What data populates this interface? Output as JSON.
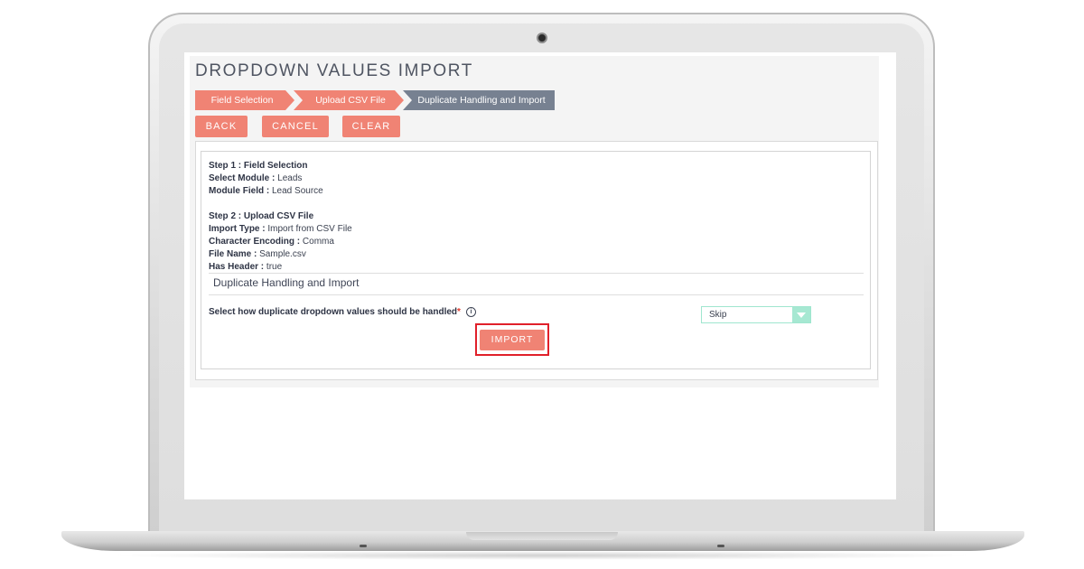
{
  "page": {
    "title": "DROPDOWN VALUES IMPORT"
  },
  "steps": [
    {
      "label": "Field Selection"
    },
    {
      "label": "Upload CSV File"
    },
    {
      "label": "Duplicate Handling and Import"
    }
  ],
  "actions": {
    "back_label": "BACK",
    "cancel_label": "CANCEL",
    "clear_label": "CLEAR"
  },
  "summary": {
    "step1_heading": "Step 1 : Field Selection",
    "select_module_label": "Select Module :",
    "select_module_value": "Leads",
    "module_field_label": "Module Field :",
    "module_field_value": "Lead Source",
    "step2_heading": "Step 2 : Upload CSV File",
    "import_type_label": "Import Type :",
    "import_type_value": "Import from CSV File",
    "char_encoding_label": "Character Encoding :",
    "char_encoding_value": "Comma",
    "file_name_label": "File Name :",
    "file_name_value": "Sample.csv",
    "has_header_label": "Has Header :",
    "has_header_value": "true"
  },
  "duplicate_section": {
    "title": "Duplicate Handling and Import",
    "question_label": "Select how duplicate dropdown values should be handled",
    "required_mark": "*",
    "info_glyph": "i",
    "select_value": "Skip",
    "import_label": "IMPORT"
  },
  "colors": {
    "accent": "#f08374",
    "active_step": "#778191",
    "highlight": "#e0202a",
    "select_border": "#9fe6cf"
  },
  "icons": {
    "info": "info-circle-icon",
    "dropdown": "chevron-down-icon",
    "camera": "camera-dot"
  }
}
